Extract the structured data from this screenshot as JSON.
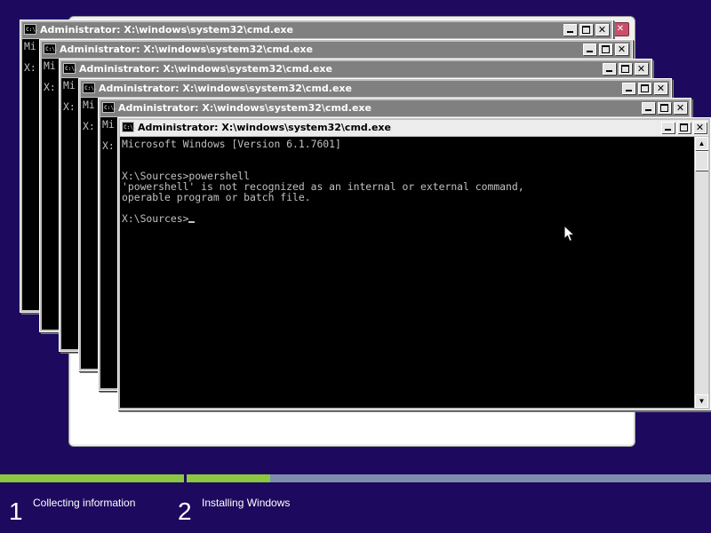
{
  "cmd_title": "Administrator: X:\\windows\\system32\\cmd.exe",
  "cmd_icon_text": "C:\\.",
  "back_console_lines": [
    "Mi",
    "",
    "X:"
  ],
  "front_console": {
    "lines": [
      "Microsoft Windows [Version 6.1.7601]",
      "",
      "",
      "X:\\Sources>powershell",
      "'powershell' is not recognized as an internal or external command,",
      "operable program or batch file.",
      "",
      "X:\\Sources>"
    ]
  },
  "setup": {
    "progress": [
      {
        "segment": "collecting",
        "fill_fraction": 1.0
      },
      {
        "segment": "installing",
        "fill_fraction": 0.16
      }
    ],
    "steps": [
      {
        "number": "1",
        "label": "Collecting information"
      },
      {
        "number": "2",
        "label": "Installing Windows"
      }
    ]
  },
  "colors": {
    "desktop": "#1d0a5e",
    "progress_fill": "#8dc63f",
    "progress_track": "#7e8dab",
    "console_bg": "#000000",
    "console_text": "#c0c0c0"
  }
}
